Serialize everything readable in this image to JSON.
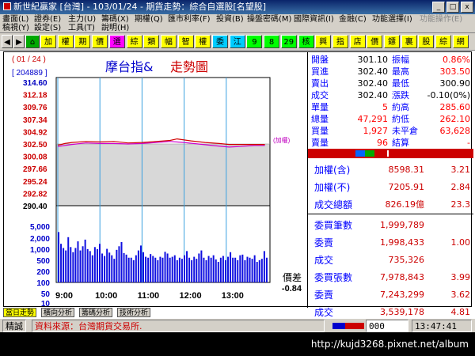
{
  "window": {
    "title": "新世紀贏家 [台灣] - 103/01/24 - 期貨走勢：綜合自選股[名望股]"
  },
  "menu_row1": [
    "畫面(L)",
    "證券(E)",
    "主力(U)",
    "籌碼(X)",
    "期權(Q)",
    "匯市利率(F)",
    "投資(B)",
    "操盤密碼(M)",
    "國際資訊(I)",
    "金融(C)",
    "功能選擇(I)",
    "功能操作(E)"
  ],
  "menu_row2": [
    "稿視(Y)",
    "設定(S)",
    "工具(T)",
    "說明(H)"
  ],
  "toolbar": [
    "加",
    "權",
    "期",
    "價",
    "選",
    "綜",
    "類",
    "幅",
    "智",
    "權",
    "委",
    "江",
    "9",
    "8",
    "29",
    "核",
    "興",
    "指",
    "店",
    "價",
    "鏢",
    "裏",
    "股",
    "綜",
    "網"
  ],
  "chart_header": {
    "counter": "( 01 / 24 )",
    "volume_total": "[ 204889 ]",
    "title": "摩台指&",
    "title2": "走勢圖",
    "ref_label": "(加權)"
  },
  "chart_data": {
    "type": "line",
    "price_ticks": [
      "314.60",
      "312.18",
      "309.76",
      "307.34",
      "304.92",
      "302.50",
      "300.08",
      "297.66",
      "295.24",
      "292.82",
      "290.40"
    ],
    "volume_ticks": [
      "5,000",
      "2,000",
      "1,000",
      "500",
      "200",
      "100",
      "50",
      "10"
    ],
    "time_ticks": [
      "9:00",
      "10:00",
      "11:00",
      "12:00",
      "13:00"
    ],
    "reference_price": 302.5,
    "ylim": [
      290.4,
      314.6
    ],
    "price_series": [
      [
        0,
        302.3
      ],
      [
        5,
        302.4
      ],
      [
        10,
        302.6
      ],
      [
        20,
        302.8
      ],
      [
        40,
        303.0
      ],
      [
        60,
        302.9
      ],
      [
        80,
        303.0
      ],
      [
        100,
        302.7
      ],
      [
        120,
        302.8
      ],
      [
        140,
        303.0
      ],
      [
        160,
        303.2
      ],
      [
        170,
        303.5
      ],
      [
        190,
        303.1
      ],
      [
        210,
        302.8
      ],
      [
        230,
        302.6
      ],
      [
        244,
        302.4
      ],
      [
        260,
        302.4
      ],
      [
        280,
        302.4
      ],
      [
        295,
        302.4
      ]
    ],
    "index_series": [
      [
        0,
        302.0
      ],
      [
        20,
        302.4
      ],
      [
        40,
        302.7
      ],
      [
        60,
        302.6
      ],
      [
        80,
        302.6
      ],
      [
        100,
        302.5
      ],
      [
        120,
        302.6
      ],
      [
        140,
        302.8
      ],
      [
        160,
        303.0
      ],
      [
        180,
        302.8
      ],
      [
        200,
        302.5
      ],
      [
        220,
        302.2
      ],
      [
        244,
        301.9
      ],
      [
        260,
        302.0
      ],
      [
        280,
        302.2
      ],
      [
        295,
        302.2
      ]
    ],
    "volume_series": [
      4200,
      600,
      300,
      200,
      1800,
      350,
      150,
      300,
      900,
      200,
      400,
      1200,
      250,
      180,
      90,
      350,
      250,
      600,
      120,
      80,
      260,
      140,
      90,
      50,
      220,
      400,
      800,
      130,
      100,
      60,
      60,
      40,
      90,
      200,
      450,
      150,
      70,
      60,
      110,
      80,
      60,
      40,
      70,
      60,
      160,
      120,
      60,
      70,
      90,
      40,
      60,
      50,
      90,
      180,
      60,
      40,
      70,
      50,
      120,
      200,
      60,
      40,
      80,
      60,
      90,
      45,
      30,
      60,
      80,
      40,
      70,
      150,
      60,
      60,
      40,
      90,
      100,
      40,
      70,
      60,
      50,
      90,
      30,
      40,
      50,
      180,
      60
    ]
  },
  "diff": {
    "label": "價差",
    "value": "-0.84"
  },
  "quote": [
    {
      "l1": "開盤",
      "v1": "301.10",
      "l2": "振幅",
      "v2": "0.86%",
      "c1": "#fff",
      "c2": "#f00"
    },
    {
      "l1": "買進",
      "v1": "302.40",
      "l2": "最高",
      "v2": "303.50",
      "c1": "#000",
      "c2": "#f00"
    },
    {
      "l1": "賣出",
      "v1": "302.40",
      "l2": "最低",
      "v2": "300.90",
      "c1": "#000",
      "c2": "#000"
    },
    {
      "l1": "成交",
      "v1": "302.40",
      "l2": "漲跌",
      "v2": "-0.10(0%)",
      "c1": "#000",
      "c2": "#000"
    },
    {
      "l1": "單量",
      "v1": "5",
      "l2": "約高",
      "v2": "285.60",
      "c1": "#f00",
      "c2": "#f00"
    },
    {
      "l1": "總量",
      "v1": "47,291",
      "l2": "約低",
      "v2": "262.10",
      "c1": "#f00",
      "c2": "#f00"
    },
    {
      "l1": "買量",
      "v1": "1,927",
      "l2": "未平倉",
      "v2": "63,628",
      "c1": "#f00",
      "c2": "#f00"
    },
    {
      "l1": "賣量",
      "v1": "96",
      "l2": "結算",
      "v2": "-",
      "c1": "#f00",
      "c2": "#f00"
    }
  ],
  "index_info": [
    {
      "label": "加權(含)",
      "value": "8598.31",
      "chg": "3.21"
    },
    {
      "label": "加權(不)",
      "value": "7205.91",
      "chg": "2.84"
    },
    {
      "label": "成交總額",
      "value": "826.19億",
      "chg": "23.3"
    }
  ],
  "order_info": [
    {
      "label": "委買筆數",
      "value": "1,999,789",
      "chg": ""
    },
    {
      "label": "委賣",
      "value": "1,998,433",
      "chg": "1.00"
    },
    {
      "label": "成交",
      "value": "735,326",
      "chg": ""
    },
    {
      "label": "委買張數",
      "value": "7,978,843",
      "chg": "3.99"
    },
    {
      "label": "委賣",
      "value": "7,243,299",
      "chg": "3.62"
    },
    {
      "label": "成交",
      "value": "3,539,178",
      "chg": "4.81"
    }
  ],
  "tabs": [
    "當日走勢",
    "橫向分析",
    "籌碼分析",
    "技術分析"
  ],
  "status": {
    "prefix": "精誠",
    "source": "資料來源：台灣期貨交易所.",
    "code": "000",
    "clock": "13:47:41"
  },
  "watermark": "http://kujd3268.pixnet.net/album",
  "colors": {
    "price_line": "#d00000",
    "index_line": "#cc00cc",
    "volume": "#1010e0",
    "grid": "#3aa0e0",
    "shade": "#d8d8d8"
  }
}
